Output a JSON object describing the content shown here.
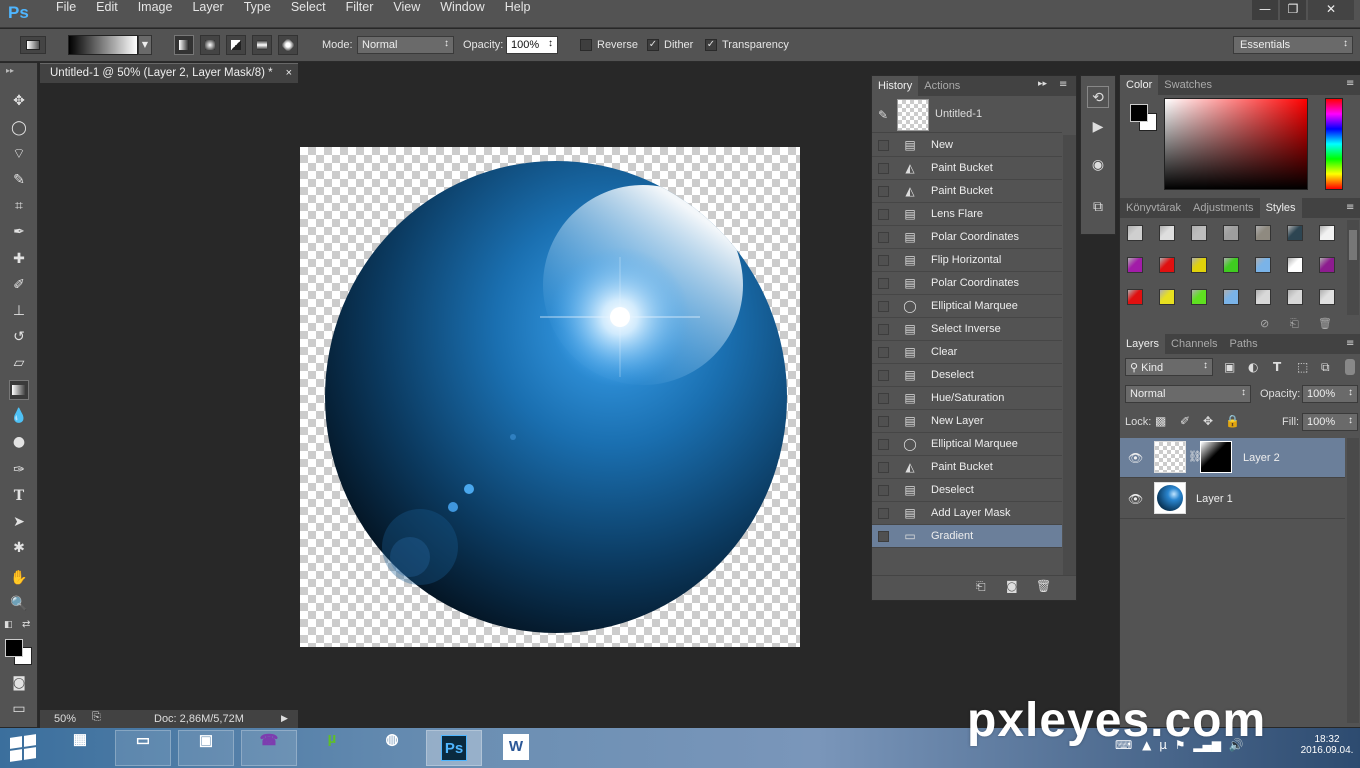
{
  "app": {
    "logo": "Ps"
  },
  "menu": [
    "File",
    "Edit",
    "Image",
    "Layer",
    "Type",
    "Select",
    "Filter",
    "View",
    "Window",
    "Help"
  ],
  "window_controls": {
    "minimize": "—",
    "restore": "❐",
    "close": "✕"
  },
  "options": {
    "mode_label": "Mode:",
    "mode_value": "Normal",
    "opacity_label": "Opacity:",
    "opacity_value": "100%",
    "reverse_label": "Reverse",
    "reverse_checked": false,
    "dither_label": "Dither",
    "dither_checked": true,
    "transparency_label": "Transparency",
    "transparency_checked": true,
    "workspace": "Essentials"
  },
  "document": {
    "tab_title": "Untitled-1 @ 50% (Layer 2, Layer Mask/8) *",
    "close": "×",
    "zoom": "50%",
    "doc_info": "Doc: 2,86M/5,72M"
  },
  "history": {
    "tabs": [
      "History",
      "Actions"
    ],
    "snapshot": "Untitled-1",
    "items": [
      {
        "label": "New",
        "icon": "doc-icon",
        "glyph": "▤"
      },
      {
        "label": "Paint Bucket",
        "icon": "paint-bucket-icon",
        "glyph": "◭"
      },
      {
        "label": "Paint Bucket",
        "icon": "paint-bucket-icon",
        "glyph": "◭"
      },
      {
        "label": "Lens Flare",
        "icon": "doc-icon",
        "glyph": "▤"
      },
      {
        "label": "Polar Coordinates",
        "icon": "doc-icon",
        "glyph": "▤"
      },
      {
        "label": "Flip Horizontal",
        "icon": "doc-icon",
        "glyph": "▤"
      },
      {
        "label": "Polar Coordinates",
        "icon": "doc-icon",
        "glyph": "▤"
      },
      {
        "label": "Elliptical Marquee",
        "icon": "ellipse-marquee-icon",
        "glyph": "◯"
      },
      {
        "label": "Select Inverse",
        "icon": "doc-icon",
        "glyph": "▤"
      },
      {
        "label": "Clear",
        "icon": "doc-icon",
        "glyph": "▤"
      },
      {
        "label": "Deselect",
        "icon": "doc-icon",
        "glyph": "▤"
      },
      {
        "label": "Hue/Saturation",
        "icon": "doc-icon",
        "glyph": "▤"
      },
      {
        "label": "New Layer",
        "icon": "doc-icon",
        "glyph": "▤"
      },
      {
        "label": "Elliptical Marquee",
        "icon": "ellipse-marquee-icon",
        "glyph": "◯"
      },
      {
        "label": "Paint Bucket",
        "icon": "paint-bucket-icon",
        "glyph": "◭"
      },
      {
        "label": "Deselect",
        "icon": "doc-icon",
        "glyph": "▤"
      },
      {
        "label": "Add Layer Mask",
        "icon": "doc-icon",
        "glyph": "▤"
      },
      {
        "label": "Gradient",
        "icon": "gradient-icon",
        "glyph": "▭"
      }
    ],
    "selected_index": 17
  },
  "color_panel": {
    "tabs": [
      "Color",
      "Swatches"
    ]
  },
  "styles_panel": {
    "tabs": [
      "Könyvtárak",
      "Adjustments",
      "Styles"
    ],
    "swatches": [
      "#cfcfcf",
      "#dedede",
      "#bdbdbd",
      "#9e9e9e",
      "#8f8a80",
      "#2d4552",
      "#f2f2f2",
      "#a21ca8",
      "#e01010",
      "#e0d20a",
      "#3fcc20",
      "#7ab3e8",
      "#ffffff",
      "#8d1c8f",
      "#e01010",
      "#e8e020",
      "#5fe020",
      "#7ab3e8",
      "#d8d8d8",
      "#d8d8d8",
      "#e0e0e0"
    ]
  },
  "layers_panel": {
    "tabs": [
      "Layers",
      "Channels",
      "Paths"
    ],
    "kind_label": "Kind",
    "blend_mode": "Normal",
    "opacity_label": "Opacity:",
    "opacity_value": "100%",
    "lock_label": "Lock:",
    "fill_label": "Fill:",
    "fill_value": "100%",
    "layers": [
      {
        "name": "Layer 2",
        "selected": true
      },
      {
        "name": "Layer 1",
        "selected": false
      }
    ]
  },
  "taskbar": {
    "apps": [
      "calculator",
      "notepad",
      "file-explorer",
      "viber",
      "utorrent",
      "chrome",
      "photoshop",
      "word"
    ],
    "ps_label": "Ps",
    "word_label": "W",
    "time": "18:32",
    "date": "2016.09.04."
  },
  "watermark": "pxleyes.com"
}
